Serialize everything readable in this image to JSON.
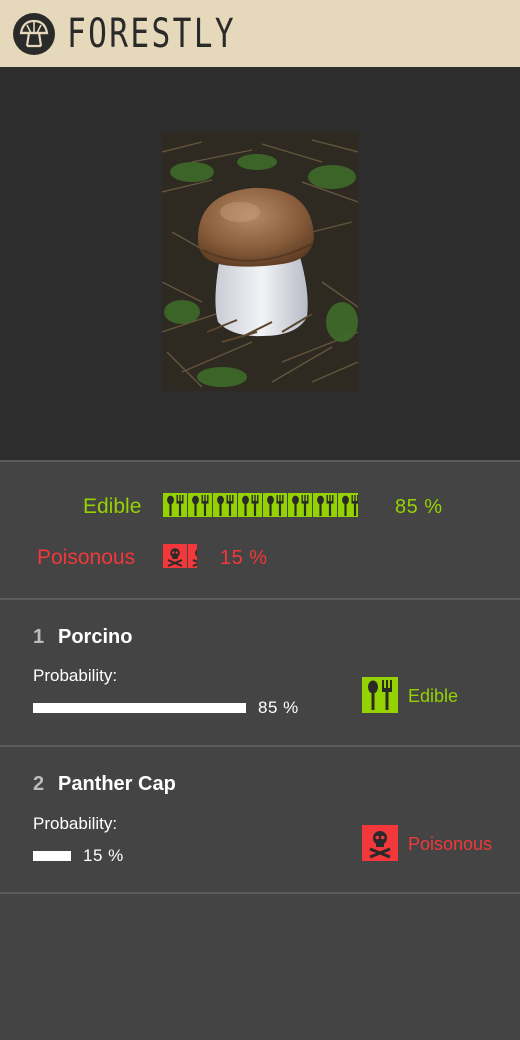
{
  "app": {
    "title": "FORESTLY",
    "logo_icon": "mushroom-logo-icon"
  },
  "photo": {
    "subject": "mushroom-photo"
  },
  "colors": {
    "header_bg": "#e6d9bb",
    "edible": "#94d200",
    "poisonous": "#f2383a",
    "panel_bg": "#444444",
    "photo_bg": "#2d2d2d"
  },
  "summary": {
    "edible": {
      "label": "Edible",
      "percent_text": "85 %",
      "value": 0.85,
      "icon": "fork-spoon-icon"
    },
    "poisonous": {
      "label": "Poisonous",
      "percent_text": "15 %",
      "value": 0.15,
      "icon": "skull-crossbones-icon"
    }
  },
  "results": [
    {
      "rank": "1",
      "name": "Porcino",
      "probability_label": "Probability:",
      "probability": 0.85,
      "percent_text": "85 %",
      "verdict": "Edible",
      "verdict_icon": "fork-spoon-icon"
    },
    {
      "rank": "2",
      "name": "Panther Cap",
      "probability_label": "Probability:",
      "probability": 0.15,
      "percent_text": "15 %",
      "verdict": "Poisonous",
      "verdict_icon": "skull-crossbones-icon"
    }
  ]
}
